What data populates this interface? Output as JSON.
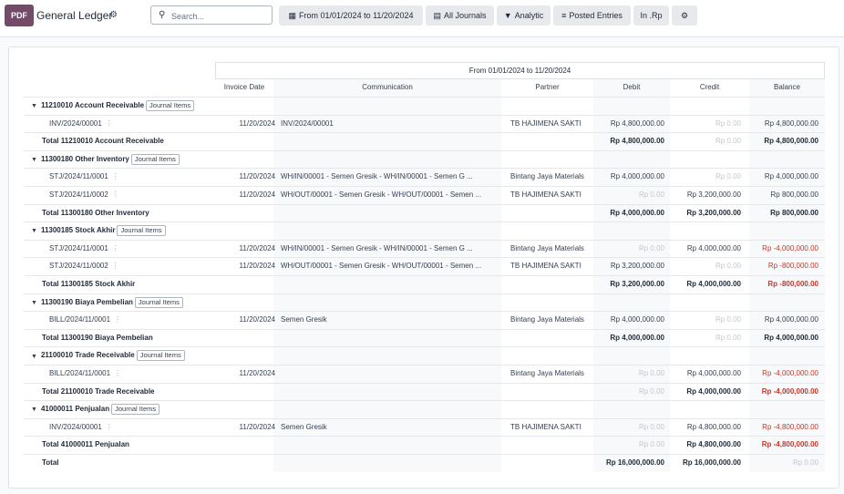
{
  "header": {
    "pdf_label": "PDF",
    "title": "General Ledger",
    "search_placeholder": "Search...",
    "filters": [
      {
        "label": "From 01/01/2024 to 11/20/2024",
        "icon": "calendar-icon"
      },
      {
        "label": "All Journals",
        "icon": "book-icon"
      },
      {
        "label": "Analytic",
        "icon": "filter-icon"
      },
      {
        "label": "Posted Entries",
        "icon": "sliders-icon"
      },
      {
        "label": "In .Rp",
        "icon": ""
      },
      {
        "label": "",
        "icon": "settings-icon"
      }
    ]
  },
  "report": {
    "period": "From 01/01/2024 to 11/20/2024",
    "columns": {
      "date": "Invoice Date",
      "communication": "Communication",
      "partner": "Partner",
      "debit": "Debit",
      "credit": "Credit",
      "balance": "Balance"
    },
    "journal_items_label": "Journal Items",
    "rows": [
      {
        "type": "account",
        "name": "11210010 Account Receivable"
      },
      {
        "type": "line",
        "name": "INV/2024/00001",
        "date": "11/20/2024",
        "comm": "INV/2024/00001",
        "partner": "TB HAJIMENA SAKTI",
        "debit": "Rp 4,800,000.00",
        "credit": "Rp 0.00",
        "balance": "Rp 4,800,000.00"
      },
      {
        "type": "total",
        "name": "Total 11210010 Account Receivable",
        "debit": "Rp 4,800,000.00",
        "credit": "Rp 0.00",
        "balance": "Rp 4,800,000.00"
      },
      {
        "type": "account",
        "name": "11300180 Other Inventory"
      },
      {
        "type": "line",
        "name": "STJ/2024/11/0001",
        "date": "11/20/2024",
        "comm": "WH/IN/00001 - Semen Gresik - WH/IN/00001 - Semen G ...",
        "partner": "Bintang Jaya Materials",
        "debit": "Rp 4,000,000.00",
        "credit": "Rp 0.00",
        "balance": "Rp 4,000,000.00"
      },
      {
        "type": "line",
        "name": "STJ/2024/11/0002",
        "date": "11/20/2024",
        "comm": "WH/OUT/00001 - Semen Gresik - WH/OUT/00001 - Semen ...",
        "partner": "TB HAJIMENA SAKTI",
        "debit": "Rp 0.00",
        "credit": "Rp 3,200,000.00",
        "balance": "Rp 800,000.00"
      },
      {
        "type": "total",
        "name": "Total 11300180 Other Inventory",
        "debit": "Rp 4,000,000.00",
        "credit": "Rp 3,200,000.00",
        "balance": "Rp 800,000.00"
      },
      {
        "type": "account",
        "name": "11300185 Stock Akhir"
      },
      {
        "type": "line",
        "name": "STJ/2024/11/0001",
        "date": "11/20/2024",
        "comm": "WH/IN/00001 - Semen Gresik - WH/IN/00001 - Semen G ...",
        "partner": "Bintang Jaya Materials",
        "debit": "Rp 0.00",
        "credit": "Rp 4,000,000.00",
        "balance": "Rp -4,000,000.00"
      },
      {
        "type": "line",
        "name": "STJ/2024/11/0002",
        "date": "11/20/2024",
        "comm": "WH/OUT/00001 - Semen Gresik - WH/OUT/00001 - Semen ...",
        "partner": "TB HAJIMENA SAKTI",
        "debit": "Rp 3,200,000.00",
        "credit": "Rp 0.00",
        "balance": "Rp -800,000.00"
      },
      {
        "type": "total",
        "name": "Total 11300185 Stock Akhir",
        "debit": "Rp 3,200,000.00",
        "credit": "Rp 4,000,000.00",
        "balance": "Rp -800,000.00"
      },
      {
        "type": "account",
        "name": "11300190 Biaya Pembelian"
      },
      {
        "type": "line",
        "name": "BILL/2024/11/0001",
        "date": "11/20/2024",
        "comm": "Semen Gresik",
        "partner": "Bintang Jaya Materials",
        "debit": "Rp 4,000,000.00",
        "credit": "Rp 0.00",
        "balance": "Rp 4,000,000.00"
      },
      {
        "type": "total",
        "name": "Total 11300190 Biaya Pembelian",
        "debit": "Rp 4,000,000.00",
        "credit": "Rp 0.00",
        "balance": "Rp 4,000,000.00"
      },
      {
        "type": "account",
        "name": "21100010 Trade Receivable"
      },
      {
        "type": "line",
        "name": "BILL/2024/11/0001",
        "date": "11/20/2024",
        "comm": "",
        "partner": "Bintang Jaya Materials",
        "debit": "Rp 0.00",
        "credit": "Rp 4,000,000.00",
        "balance": "Rp -4,000,000.00"
      },
      {
        "type": "total",
        "name": "Total 21100010 Trade Receivable",
        "debit": "Rp 0.00",
        "credit": "Rp 4,000,000.00",
        "balance": "Rp -4,000,000.00"
      },
      {
        "type": "account",
        "name": "41000011 Penjualan"
      },
      {
        "type": "line",
        "name": "INV/2024/00001",
        "date": "11/20/2024",
        "comm": "Semen Gresik",
        "partner": "TB HAJIMENA SAKTI",
        "debit": "Rp 0.00",
        "credit": "Rp 4,800,000.00",
        "balance": "Rp -4,800,000.00"
      },
      {
        "type": "total",
        "name": "Total 41000011 Penjualan",
        "debit": "Rp 0.00",
        "credit": "Rp 4,800,000.00",
        "balance": "Rp -4,800,000.00"
      },
      {
        "type": "grand",
        "name": "Total",
        "debit": "Rp 16,000,000.00",
        "credit": "Rp 16,000,000.00",
        "balance": "Rp 0.00"
      }
    ]
  }
}
